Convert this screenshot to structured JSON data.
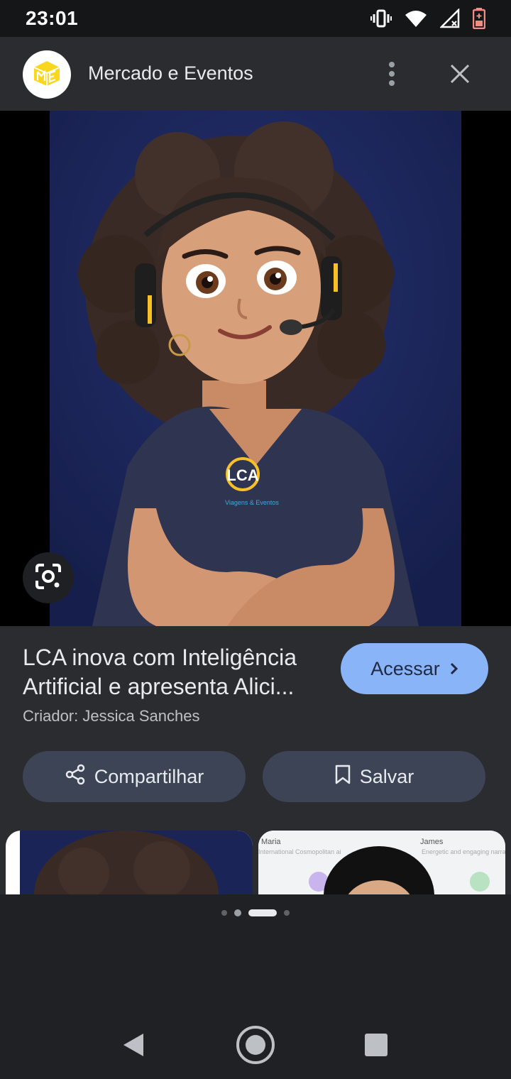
{
  "status_bar": {
    "time": "23:01",
    "icons": [
      "vibrate-icon",
      "wifi-icon",
      "signal-icon",
      "battery-icon"
    ]
  },
  "header": {
    "site_name": "Mercado e Eventos",
    "logo_icon": "mercado-eventos-logo",
    "more_icon": "more-vert-icon",
    "close_icon": "close-icon"
  },
  "image": {
    "lens_icon": "google-lens-icon",
    "shirt_logo_text": "LCA",
    "shirt_logo_subtext": "Viagens & Eventos"
  },
  "result": {
    "title": "LCA inova com Inteligência Artificial e apresenta Alici...",
    "creator": "Criador: Jessica Sanches",
    "visit_label": "Acessar",
    "share_label": "Compartilhar",
    "save_label": "Salvar"
  },
  "related": {
    "thumb2_names": [
      "Maria",
      "James"
    ],
    "thumb2_caption_left": "International Cosmopolitan ai",
    "thumb2_caption_right": "Energetic and engaging narrat"
  },
  "colors": {
    "accent": "#8ab4f8",
    "panel": "#2b2c30",
    "pill": "#3c4456",
    "image_bg": "#1a2456"
  }
}
